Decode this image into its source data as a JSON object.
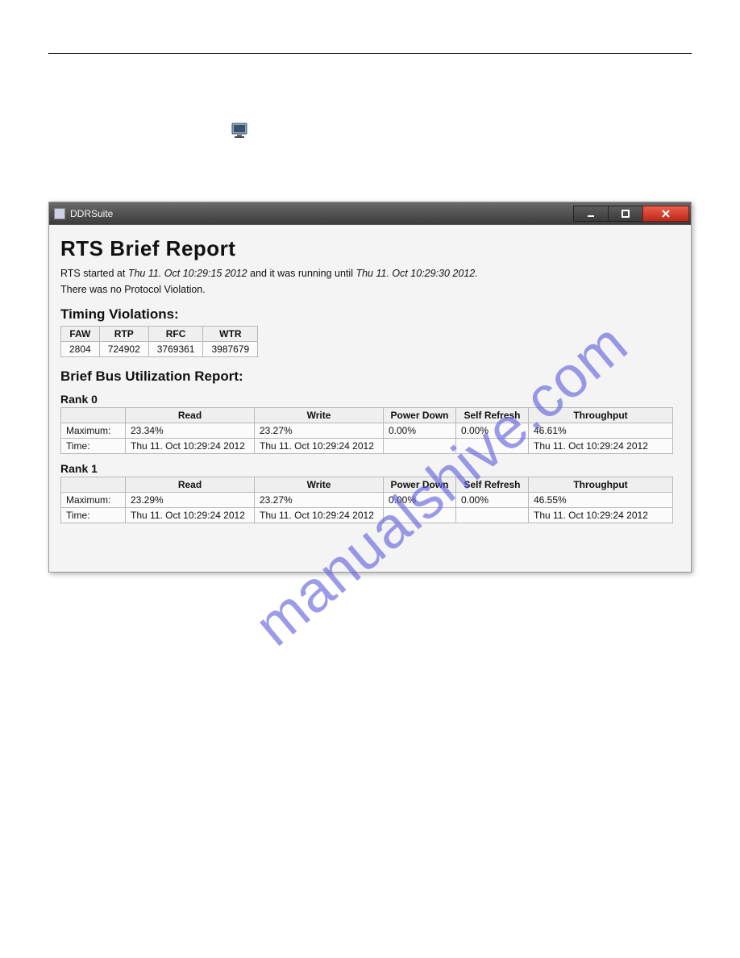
{
  "window": {
    "title": "DDRSuite"
  },
  "report": {
    "title": "RTS Brief Report",
    "started_prefix": "RTS started at ",
    "started_time": "Thu 11. Oct 10:29:15 2012",
    "started_mid": " and it was running until ",
    "ended_time": "Thu 11. Oct 10:29:30 2012.",
    "no_violation": "There was no Protocol Violation."
  },
  "timing": {
    "heading": "Timing Violations:",
    "headers": [
      "FAW",
      "RTP",
      "RFC",
      "WTR"
    ],
    "values": [
      "2804",
      "724902",
      "3769361",
      "3987679"
    ]
  },
  "bus": {
    "heading": "Brief Bus Utilization Report:",
    "col_headers": [
      "",
      "Read",
      "Write",
      "Power Down",
      "Self Refresh",
      "Throughput"
    ],
    "row_labels": {
      "max": "Maximum:",
      "time": "Time:"
    },
    "ranks": [
      {
        "label": "Rank 0",
        "max": [
          "23.34%",
          "23.27%",
          "0.00%",
          "0.00%",
          "46.61%"
        ],
        "time": [
          "Thu 11. Oct 10:29:24 2012",
          "Thu 11. Oct 10:29:24 2012",
          "",
          "",
          "Thu 11. Oct 10:29:24 2012"
        ]
      },
      {
        "label": "Rank 1",
        "max": [
          "23.29%",
          "23.27%",
          "0.00%",
          "0.00%",
          "46.55%"
        ],
        "time": [
          "Thu 11. Oct 10:29:24 2012",
          "Thu 11. Oct 10:29:24 2012",
          "",
          "",
          "Thu 11. Oct 10:29:24 2012"
        ]
      }
    ]
  },
  "watermark": "manualshive.com"
}
